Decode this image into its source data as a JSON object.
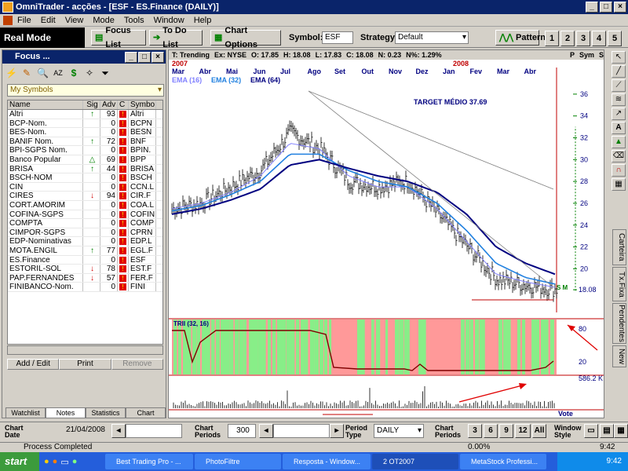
{
  "window": {
    "title": "OmniTrader - acções - [ESF - ES.Finance (DAILY)]"
  },
  "menu": [
    "File",
    "Edit",
    "View",
    "Mode",
    "Tools",
    "Window",
    "Help"
  ],
  "toolbar": {
    "mode": "Real Mode",
    "focus_list": "Focus List",
    "todo_list": "To Do List",
    "chart_options": "Chart Options",
    "symbol_label": "Symbol:",
    "symbol_value": "ESF",
    "strategy_label": "Strategy:",
    "strategy_value": "Default",
    "patterns": "Patterns",
    "layouts": [
      "1",
      "2",
      "3",
      "4",
      "5"
    ]
  },
  "focus": {
    "title": "Focus ...",
    "list_name": "My Symbols",
    "columns": [
      "Name",
      "Sig",
      "Adv",
      "C",
      "Symbo"
    ],
    "rows": [
      {
        "name": "Altri",
        "sig": "up",
        "adv": "93",
        "c": "bad",
        "sym": "Altri"
      },
      {
        "name": "BCP-Nom.",
        "sig": "",
        "adv": "0",
        "c": "bad",
        "sym": "BCPN"
      },
      {
        "name": "BES-Nom.",
        "sig": "",
        "adv": "0",
        "c": "bad",
        "sym": "BESN"
      },
      {
        "name": "BANIF Nom.",
        "sig": "up",
        "adv": "72",
        "c": "bad",
        "sym": "BNF"
      },
      {
        "name": "BPI-SGPS Nom.",
        "sig": "",
        "adv": "0",
        "c": "bad",
        "sym": "BPIN."
      },
      {
        "name": "Banco Popular",
        "sig": "tri",
        "adv": "69",
        "c": "bad",
        "sym": "BPP"
      },
      {
        "name": "BRISA",
        "sig": "up",
        "adv": "44",
        "c": "bad",
        "sym": "BRISA"
      },
      {
        "name": "BSCH-NOM",
        "sig": "",
        "adv": "0",
        "c": "bad",
        "sym": "BSCH"
      },
      {
        "name": "CIN",
        "sig": "",
        "adv": "0",
        "c": "bad",
        "sym": "CCN.L"
      },
      {
        "name": "CIRES",
        "sig": "dn",
        "adv": "94",
        "c": "bad",
        "sym": "CIR.F"
      },
      {
        "name": "CORT.AMORIM",
        "sig": "",
        "adv": "0",
        "c": "bad",
        "sym": "COA.L"
      },
      {
        "name": "COFINA-SGPS",
        "sig": "",
        "adv": "0",
        "c": "bad",
        "sym": "COFIN"
      },
      {
        "name": "COMPTA",
        "sig": "",
        "adv": "0",
        "c": "bad",
        "sym": "COMP"
      },
      {
        "name": "CIMPOR-SGPS",
        "sig": "",
        "adv": "0",
        "c": "bad",
        "sym": "CPRN"
      },
      {
        "name": "EDP-Nominativas",
        "sig": "",
        "adv": "0",
        "c": "bad",
        "sym": "EDP.L"
      },
      {
        "name": "MOTA.ENGIL",
        "sig": "up",
        "adv": "77",
        "c": "bad",
        "sym": "EGL.F"
      },
      {
        "name": "ES.Finance",
        "sig": "",
        "adv": "0",
        "c": "bad",
        "sym": "ESF"
      },
      {
        "name": "ESTORIL-SOL",
        "sig": "dn",
        "adv": "78",
        "c": "bad",
        "sym": "EST.F"
      },
      {
        "name": "PAP.FERNANDES",
        "sig": "dn",
        "adv": "57",
        "c": "bad",
        "sym": "FER.F"
      },
      {
        "name": "FINIBANCO-Nom.",
        "sig": "",
        "adv": "0",
        "c": "bad",
        "sym": "FINI"
      }
    ],
    "buttons": [
      "Add / Edit",
      "Print",
      "Remove"
    ],
    "tabs": [
      "Watchlist",
      "Notes",
      "Statistics",
      "Chart"
    ]
  },
  "chart_header": {
    "mode": "T: Trending",
    "exchange": "Ex: NYSE",
    "open": "O: 17.85",
    "high": "H: 18.08",
    "low": "L: 17.83",
    "close": "C: 18.08",
    "net": "N: 0.23",
    "pct": "N%: 1.29%",
    "p_btn": "P",
    "sym_btn": "Sym",
    "s_btn": "S"
  },
  "chart": {
    "years": [
      "2007",
      "2008"
    ],
    "months": [
      "Mar",
      "Abr",
      "Mai",
      "Jun",
      "Jul",
      "Ago",
      "Set",
      "Out",
      "Nov",
      "Dez",
      "Jan",
      "Fev",
      "Mar",
      "Abr"
    ],
    "emas": [
      {
        "label": "EMA (16)",
        "color": "#8080ff"
      },
      {
        "label": "EMA (32)",
        "color": "#2080e0"
      },
      {
        "label": "EMA (64)",
        "color": "#000080"
      }
    ],
    "annotation": "TARGET MÉDIO 37.69",
    "price_ticks": [
      "36",
      "34",
      "32",
      "30",
      "28",
      "26",
      "24",
      "22",
      "20",
      "18.08"
    ],
    "last_price": "18.08",
    "indicator_label": "TRII (32, 16)",
    "indicator_ticks": [
      "80",
      "20"
    ],
    "volume_label": "586.2 K",
    "vote": "Vote",
    "sm": "S M"
  },
  "chart_data": {
    "type": "line",
    "title": "",
    "xlabel": "",
    "ylabel": "",
    "x": [
      "Mar 2007",
      "Abr",
      "Mai",
      "Jun",
      "Jul",
      "Ago",
      "Set",
      "Out",
      "Nov",
      "Dez",
      "Jan 2008",
      "Fev",
      "Mar",
      "Abr"
    ],
    "series": [
      {
        "name": "",
        "values": [
          25.5,
          26,
          27.5,
          29,
          32.5,
          31,
          28,
          27.5,
          28,
          25,
          22,
          19,
          18.5,
          18.08
        ]
      },
      {
        "name": "EMA (16)",
        "values": [
          25.5,
          26,
          27,
          28.5,
          31.5,
          31,
          28.5,
          27.5,
          27.5,
          25.5,
          22.5,
          19.5,
          18.8,
          18.3
        ]
      },
      {
        "name": "EMA (32)",
        "values": [
          25.3,
          25.8,
          26.8,
          28,
          30.5,
          30.5,
          29,
          28,
          27.5,
          26,
          23.5,
          20.5,
          19.2,
          18.6
        ]
      },
      {
        "name": "EMA (64)",
        "values": [
          25,
          25.5,
          26.3,
          27.3,
          29.5,
          30,
          29.2,
          28.5,
          28,
          27,
          25,
          22,
          20.5,
          19.5
        ]
      }
    ],
    "ylim": [
      16,
      37
    ]
  },
  "right_tabs": [
    "Carteira",
    "Tx.Fixa",
    "Pendentes",
    "New"
  ],
  "bottom": {
    "chart_date_label": "Chart Date",
    "chart_date": "21/04/2008",
    "chart_periods_label": "Chart Periods",
    "chart_periods": "300",
    "period_type_label": "Period Type",
    "period_type": "DAILY",
    "chart_periods2_label": "Chart Periods",
    "period_buttons": [
      "3",
      "6",
      "9",
      "12",
      "All"
    ],
    "window_style_label": "Window Style"
  },
  "status": {
    "text": "Process Completed",
    "pct": "0.00%",
    "time": "9:42"
  },
  "taskbar": {
    "start": "start",
    "items": [
      "Best Trading Pro - ...",
      "PhotoFiltre",
      "Resposta - Window...",
      "2 OT2007",
      "MetaStock Professi..."
    ],
    "clock": "9:42"
  }
}
